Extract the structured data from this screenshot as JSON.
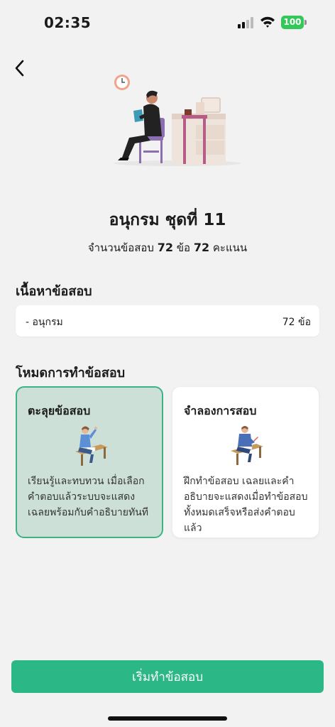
{
  "status_bar": {
    "time": "02:35",
    "battery": "100"
  },
  "exam": {
    "title": "อนุกรม ชุดที่ 11",
    "summary_prefix": "จำนวนข้อสอบ",
    "question_count": "72",
    "question_unit": "ข้อ",
    "score": "72",
    "score_unit": "คะแนน"
  },
  "content_section": {
    "heading": "เนื้อหาข้อสอบ",
    "items": [
      {
        "name": "- อนุกรม",
        "count": "72 ข้อ"
      }
    ]
  },
  "mode_section": {
    "heading": "โหมดการทำข้อสอบ",
    "modes": [
      {
        "title": "ตะลุยข้อสอบ",
        "description": "เรียนรู้และทบทวน เมื่อเลือกคำตอบแล้วระบบจะแสดงเฉลยพร้อมกับคำอธิบายทันที",
        "selected": true
      },
      {
        "title": "จำลองการสอบ",
        "description": "ฝึกทำข้อสอบ เฉลยและคำอธิบายจะแสดงเมื่อทำข้อสอบทั้งหมดเสร็จหรือส่งคำตอบแล้ว",
        "selected": false
      }
    ]
  },
  "start_button": {
    "label": "เริ่มทำข้อสอบ"
  },
  "colors": {
    "accent": "#2cb886",
    "selected_card_bg": "#cde0d7",
    "selected_card_border": "#3bb386",
    "battery": "#34c759"
  }
}
